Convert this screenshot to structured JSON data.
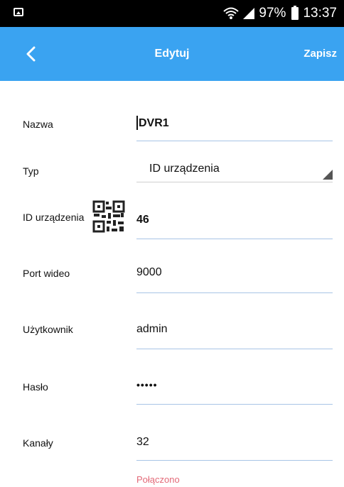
{
  "status_bar": {
    "battery": "97%",
    "time": "13:37"
  },
  "header": {
    "title": "Edytuj",
    "save_label": "Zapisz"
  },
  "form": {
    "name": {
      "label": "Nazwa",
      "value": "DVR1"
    },
    "type": {
      "label": "Typ",
      "value": "ID urządzenia"
    },
    "device_id": {
      "label": "ID urządzenia",
      "value": "46"
    },
    "video_port": {
      "label": "Port wideo",
      "value": "9000"
    },
    "user": {
      "label": "Użytkownik",
      "value": "admin"
    },
    "password": {
      "label": "Hasło",
      "value": "•••••"
    },
    "channels": {
      "label": "Kanały",
      "value": "32"
    }
  },
  "connection_status": "Połączono",
  "colors": {
    "accent": "#3aa3f1",
    "underline": "#a8c4e6",
    "status": "#e36a78"
  }
}
